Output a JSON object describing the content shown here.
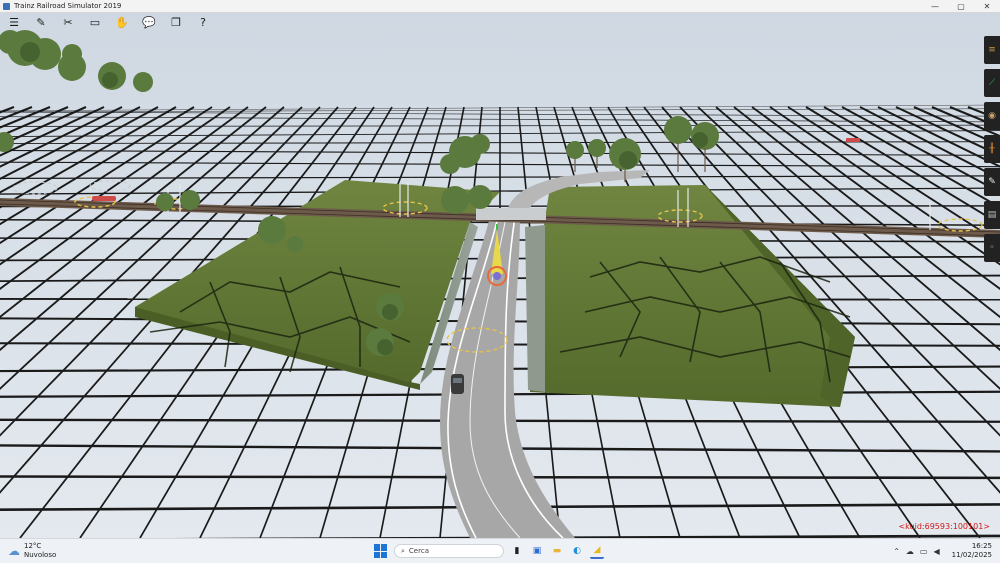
{
  "window": {
    "title": "Trainz Railroad Simulator 2019",
    "controls": {
      "minimize": "—",
      "maximize": "▢",
      "close": "✕"
    }
  },
  "toolbar": {
    "items": [
      {
        "name": "menu-icon",
        "glyph": "☰"
      },
      {
        "name": "edit-tool-icon",
        "glyph": "✎"
      },
      {
        "name": "tools-icon",
        "glyph": "✂"
      },
      {
        "name": "display-icon",
        "glyph": "▭"
      },
      {
        "name": "drive-icon",
        "glyph": "✋"
      },
      {
        "name": "chat-icon",
        "glyph": "💬"
      },
      {
        "name": "layers-icon",
        "glyph": "❐"
      },
      {
        "name": "help-icon",
        "glyph": "?"
      }
    ]
  },
  "palette": {
    "items": [
      {
        "name": "track-tool-icon",
        "glyph": "≡",
        "color": "#c89a3c"
      },
      {
        "name": "track-spline-icon",
        "glyph": "⟋",
        "color": "#3fb04a"
      },
      {
        "name": "objects-tool-icon",
        "glyph": "◉",
        "color": "#c6a06a"
      },
      {
        "name": "ladder-tool-icon",
        "glyph": "╫",
        "color": "#d6862c"
      },
      {
        "name": "wrench-tool-icon",
        "glyph": "✎",
        "color": "#e8e8e8"
      },
      {
        "name": "layers-tool-icon",
        "glyph": "▤",
        "color": "#bdbdbd"
      },
      {
        "name": "info-tool-icon",
        "glyph": "◦",
        "color": "#bdbdbd"
      }
    ]
  },
  "scene": {
    "colors": {
      "sky": "#dfe6ee",
      "ground": "#e8ecf1",
      "grass": "#5f7536",
      "road": "#a6a6a6",
      "rail": "#5b4a3c"
    }
  },
  "debug_text": "<kuid:69593:100101>",
  "taskbar": {
    "weather": {
      "temp": "12°C",
      "condition": "Nuvoloso"
    },
    "search_placeholder": "Cerca",
    "tray": {
      "time": "16:25",
      "date": "11/02/2025"
    }
  }
}
